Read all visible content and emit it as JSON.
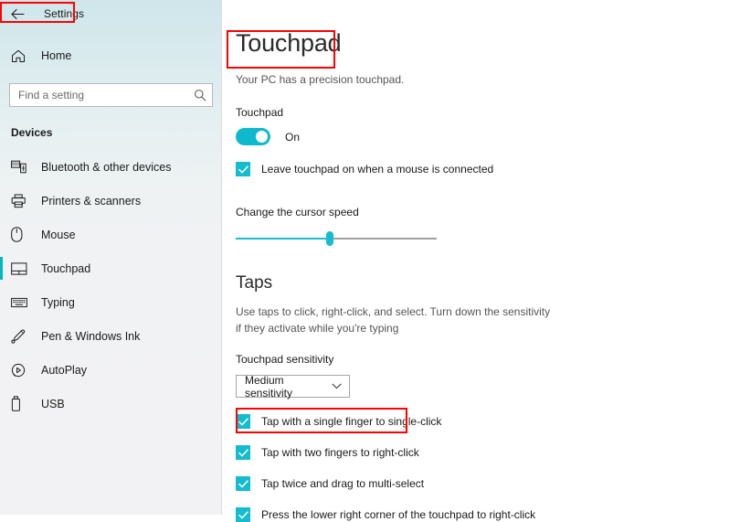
{
  "window": {
    "title": "Settings",
    "back_icon": "back-arrow-icon"
  },
  "sidebar": {
    "home": {
      "label": "Home",
      "icon": "home-icon"
    },
    "search": {
      "placeholder": "Find a setting",
      "value": "",
      "icon": "search-icon"
    },
    "section_header": "Devices",
    "items": [
      {
        "label": "Bluetooth & other devices",
        "icon": "bluetooth-devices-icon",
        "selected": false
      },
      {
        "label": "Printers & scanners",
        "icon": "printer-icon",
        "selected": false
      },
      {
        "label": "Mouse",
        "icon": "mouse-icon",
        "selected": false
      },
      {
        "label": "Touchpad",
        "icon": "touchpad-icon",
        "selected": true
      },
      {
        "label": "Typing",
        "icon": "keyboard-icon",
        "selected": false
      },
      {
        "label": "Pen & Windows Ink",
        "icon": "pen-icon",
        "selected": false
      },
      {
        "label": "AutoPlay",
        "icon": "autoplay-icon",
        "selected": false
      },
      {
        "label": "USB",
        "icon": "usb-icon",
        "selected": false
      }
    ]
  },
  "main": {
    "page_title": "Touchpad",
    "subtitle": "Your PC has a precision touchpad.",
    "touchpad_group_label": "Touchpad",
    "toggle": {
      "state_label": "On",
      "on": true
    },
    "leave_on_checkbox": {
      "label": "Leave touchpad on when a mouse is connected",
      "checked": true
    },
    "cursor_speed": {
      "label": "Change the cursor speed",
      "value_percent": 47
    },
    "taps": {
      "title": "Taps",
      "description": "Use taps to click, right-click, and select. Turn down the sensitivity if they activate while you're typing",
      "sensitivity_label": "Touchpad sensitivity",
      "sensitivity_value": "Medium sensitivity",
      "checkboxes": [
        {
          "label": "Tap with a single finger to single-click",
          "checked": true
        },
        {
          "label": "Tap with two fingers to right-click",
          "checked": true
        },
        {
          "label": "Tap twice and drag to multi-select",
          "checked": true
        },
        {
          "label": "Press the lower right corner of the touchpad to right-click",
          "checked": true
        }
      ]
    }
  },
  "annotations": {
    "accent_color": "#ff0000",
    "boxes": [
      {
        "target": "settings-title"
      },
      {
        "target": "page-title"
      },
      {
        "target": "two-finger-right-click-checkbox"
      }
    ]
  },
  "colors": {
    "accent_teal": "#00b7c3",
    "toggle_on": "#0fb9cd",
    "checkbox_fill": "#13bcce",
    "slider_fill": "#19bfd3",
    "annotation_red": "#ff0000"
  }
}
